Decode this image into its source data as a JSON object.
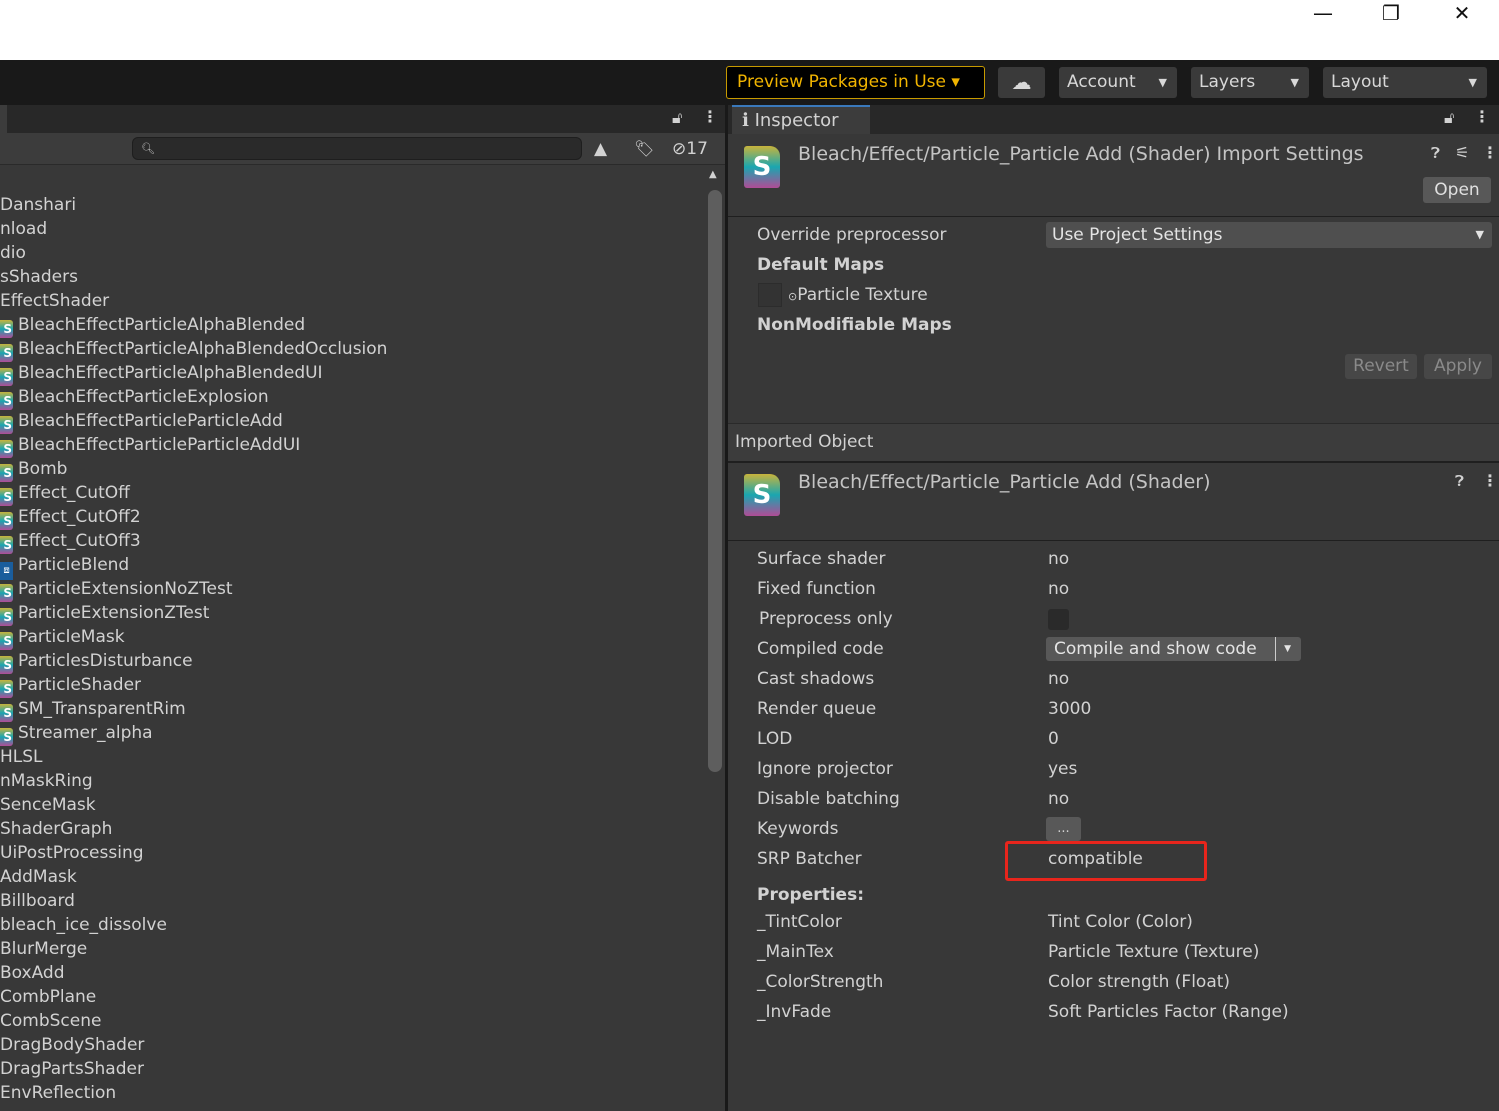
{
  "window": {
    "minimize": "—",
    "maximize": "❐",
    "close": "✕"
  },
  "toolbar": {
    "preview_packages": "Preview Packages in Use ▾",
    "account": "Account",
    "layers": "Layers",
    "layout": "Layout",
    "cloud_icon": "cloud-icon"
  },
  "project": {
    "hidden_count": "17",
    "search_placeholder": "",
    "items": [
      {
        "label": "Danshari",
        "icon": "folder"
      },
      {
        "label": "nload",
        "icon": "folder"
      },
      {
        "label": "dio",
        "icon": "folder"
      },
      {
        "label": "sShaders",
        "icon": "folder"
      },
      {
        "label": "EffectShader",
        "icon": "folder"
      },
      {
        "label": "BleachEffectParticleAlphaBlended",
        "icon": "shader"
      },
      {
        "label": "BleachEffectParticleAlphaBlendedOcclusion",
        "icon": "shader"
      },
      {
        "label": "BleachEffectParticleAlphaBlendedUI",
        "icon": "shader"
      },
      {
        "label": "BleachEffectParticleExplosion",
        "icon": "shader"
      },
      {
        "label": "BleachEffectParticleParticleAdd",
        "icon": "shader"
      },
      {
        "label": "BleachEffectParticleParticleAddUI",
        "icon": "shader"
      },
      {
        "label": "Bomb",
        "icon": "shader"
      },
      {
        "label": "Effect_CutOff",
        "icon": "shader"
      },
      {
        "label": "Effect_CutOff2",
        "icon": "shader"
      },
      {
        "label": "Effect_CutOff3",
        "icon": "shader"
      },
      {
        "label": "ParticleBlend",
        "icon": "blend"
      },
      {
        "label": "ParticleExtensionNoZTest",
        "icon": "shader"
      },
      {
        "label": "ParticleExtensionZTest",
        "icon": "shader"
      },
      {
        "label": "ParticleMask",
        "icon": "shader"
      },
      {
        "label": "ParticlesDisturbance",
        "icon": "shader"
      },
      {
        "label": "ParticleShader",
        "icon": "shader"
      },
      {
        "label": "SM_TransparentRim",
        "icon": "shader"
      },
      {
        "label": "Streamer_alpha",
        "icon": "shader"
      },
      {
        "label": "HLSL",
        "icon": "folder"
      },
      {
        "label": "nMaskRing",
        "icon": "folder"
      },
      {
        "label": "SenceMask",
        "icon": "folder"
      },
      {
        "label": "ShaderGraph",
        "icon": "folder"
      },
      {
        "label": "UiPostProcessing",
        "icon": "folder"
      },
      {
        "label": "AddMask",
        "icon": "folder"
      },
      {
        "label": "Billboard",
        "icon": "folder"
      },
      {
        "label": "bleach_ice_dissolve",
        "icon": "folder"
      },
      {
        "label": "BlurMerge",
        "icon": "folder"
      },
      {
        "label": "BoxAdd",
        "icon": "folder"
      },
      {
        "label": "CombPlane",
        "icon": "folder"
      },
      {
        "label": "CombScene",
        "icon": "folder"
      },
      {
        "label": "DragBodyShader",
        "icon": "folder"
      },
      {
        "label": "DragPartsShader",
        "icon": "folder"
      },
      {
        "label": "EnvReflection",
        "icon": "folder"
      }
    ]
  },
  "inspector": {
    "tab": "Inspector",
    "import_title": "Bleach/Effect/Particle_Particle Add (Shader) Import Settings",
    "open": "Open",
    "override_label": "Override preprocessor",
    "override_value": "Use Project Settings",
    "default_maps": "Default Maps",
    "particle_texture": "Particle Texture",
    "nonmodifiable": "NonModifiable Maps",
    "revert": "Revert",
    "apply": "Apply",
    "imported_object": "Imported Object",
    "object_title": "Bleach/Effect/Particle_Particle Add (Shader)",
    "rows": [
      {
        "label": "Surface shader",
        "value": "no"
      },
      {
        "label": "Fixed function",
        "value": "no"
      },
      {
        "label": "Preprocess only",
        "value": ""
      },
      {
        "label": "Compiled code",
        "value": "Compile and show code"
      },
      {
        "label": "Cast shadows",
        "value": "no"
      },
      {
        "label": "Render queue",
        "value": "3000"
      },
      {
        "label": "LOD",
        "value": "0"
      },
      {
        "label": "Ignore projector",
        "value": "yes"
      },
      {
        "label": "Disable batching",
        "value": "no"
      },
      {
        "label": "Keywords",
        "value": "..."
      },
      {
        "label": "SRP Batcher",
        "value": "compatible"
      }
    ],
    "properties_label": "Properties:",
    "properties": [
      {
        "name": "_TintColor",
        "value": "Tint Color (Color)"
      },
      {
        "name": "_MainTex",
        "value": "Particle Texture (Texture)"
      },
      {
        "name": "_ColorStrength",
        "value": "Color strength (Float)"
      },
      {
        "name": "_InvFade",
        "value": "Soft Particles Factor (Range)"
      }
    ],
    "highlight_color": "#e8251c"
  }
}
